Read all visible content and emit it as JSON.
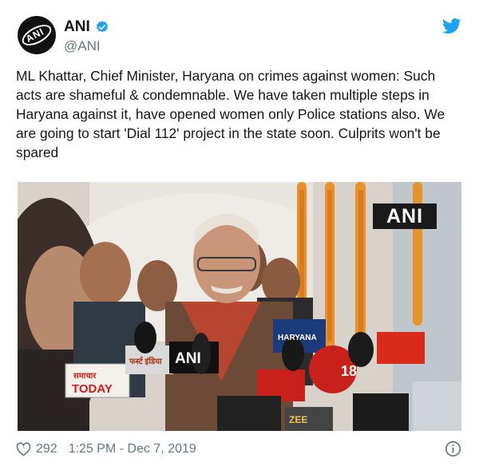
{
  "author": {
    "display_name": "ANI",
    "handle": "@ANI",
    "avatar_text": "ANI",
    "verified": true
  },
  "tweet": {
    "text": "ML Khattar, Chief Minister, Haryana on crimes against women: Such acts are shameful & condemnable. We have taken multiple steps in Haryana against it, have opened women only Police stations also. We are going to start 'Dial 112' project in the state soon. Culprits won't be spared"
  },
  "media": {
    "watermark": "ANI",
    "mic_labels": {
      "ani": "ANI",
      "today_top": "समाचार",
      "today": "TODAY",
      "first_india": "फर्स्ट इंडिया",
      "haryana": "HARYANA",
      "news18": "18",
      "zee": "ZEE"
    }
  },
  "footer": {
    "like_count": "292",
    "timestamp": "1:25 PM - Dec 7, 2019"
  },
  "colors": {
    "verified": "#1da1f2",
    "twitter_blue": "#1da1f2",
    "secondary_text": "#657786",
    "marigold": "#e8932a"
  },
  "icons": {
    "brand": "twitter-bird-icon",
    "verified": "verified-badge-icon",
    "like": "heart-icon",
    "info": "info-icon"
  }
}
